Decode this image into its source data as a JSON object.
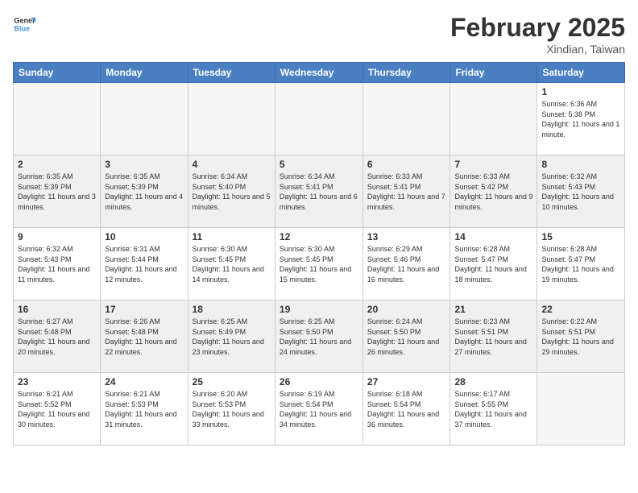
{
  "logo": {
    "line1": "General",
    "line2": "Blue"
  },
  "title": "February 2025",
  "location": "Xindian, Taiwan",
  "days_of_week": [
    "Sunday",
    "Monday",
    "Tuesday",
    "Wednesday",
    "Thursday",
    "Friday",
    "Saturday"
  ],
  "weeks": [
    {
      "shaded": false,
      "days": [
        {
          "num": "",
          "info": ""
        },
        {
          "num": "",
          "info": ""
        },
        {
          "num": "",
          "info": ""
        },
        {
          "num": "",
          "info": ""
        },
        {
          "num": "",
          "info": ""
        },
        {
          "num": "",
          "info": ""
        },
        {
          "num": "1",
          "info": "Sunrise: 6:36 AM\nSunset: 5:38 PM\nDaylight: 11 hours and 1 minute."
        }
      ]
    },
    {
      "shaded": true,
      "days": [
        {
          "num": "2",
          "info": "Sunrise: 6:35 AM\nSunset: 5:39 PM\nDaylight: 11 hours and 3 minutes."
        },
        {
          "num": "3",
          "info": "Sunrise: 6:35 AM\nSunset: 5:39 PM\nDaylight: 11 hours and 4 minutes."
        },
        {
          "num": "4",
          "info": "Sunrise: 6:34 AM\nSunset: 5:40 PM\nDaylight: 11 hours and 5 minutes."
        },
        {
          "num": "5",
          "info": "Sunrise: 6:34 AM\nSunset: 5:41 PM\nDaylight: 11 hours and 6 minutes."
        },
        {
          "num": "6",
          "info": "Sunrise: 6:33 AM\nSunset: 5:41 PM\nDaylight: 11 hours and 7 minutes."
        },
        {
          "num": "7",
          "info": "Sunrise: 6:33 AM\nSunset: 5:42 PM\nDaylight: 11 hours and 9 minutes."
        },
        {
          "num": "8",
          "info": "Sunrise: 6:32 AM\nSunset: 5:43 PM\nDaylight: 11 hours and 10 minutes."
        }
      ]
    },
    {
      "shaded": false,
      "days": [
        {
          "num": "9",
          "info": "Sunrise: 6:32 AM\nSunset: 5:43 PM\nDaylight: 11 hours and 11 minutes."
        },
        {
          "num": "10",
          "info": "Sunrise: 6:31 AM\nSunset: 5:44 PM\nDaylight: 11 hours and 12 minutes."
        },
        {
          "num": "11",
          "info": "Sunrise: 6:30 AM\nSunset: 5:45 PM\nDaylight: 11 hours and 14 minutes."
        },
        {
          "num": "12",
          "info": "Sunrise: 6:30 AM\nSunset: 5:45 PM\nDaylight: 11 hours and 15 minutes."
        },
        {
          "num": "13",
          "info": "Sunrise: 6:29 AM\nSunset: 5:46 PM\nDaylight: 11 hours and 16 minutes."
        },
        {
          "num": "14",
          "info": "Sunrise: 6:28 AM\nSunset: 5:47 PM\nDaylight: 11 hours and 18 minutes."
        },
        {
          "num": "15",
          "info": "Sunrise: 6:28 AM\nSunset: 5:47 PM\nDaylight: 11 hours and 19 minutes."
        }
      ]
    },
    {
      "shaded": true,
      "days": [
        {
          "num": "16",
          "info": "Sunrise: 6:27 AM\nSunset: 5:48 PM\nDaylight: 11 hours and 20 minutes."
        },
        {
          "num": "17",
          "info": "Sunrise: 6:26 AM\nSunset: 5:48 PM\nDaylight: 11 hours and 22 minutes."
        },
        {
          "num": "18",
          "info": "Sunrise: 6:25 AM\nSunset: 5:49 PM\nDaylight: 11 hours and 23 minutes."
        },
        {
          "num": "19",
          "info": "Sunrise: 6:25 AM\nSunset: 5:50 PM\nDaylight: 11 hours and 24 minutes."
        },
        {
          "num": "20",
          "info": "Sunrise: 6:24 AM\nSunset: 5:50 PM\nDaylight: 11 hours and 26 minutes."
        },
        {
          "num": "21",
          "info": "Sunrise: 6:23 AM\nSunset: 5:51 PM\nDaylight: 11 hours and 27 minutes."
        },
        {
          "num": "22",
          "info": "Sunrise: 6:22 AM\nSunset: 5:51 PM\nDaylight: 11 hours and 29 minutes."
        }
      ]
    },
    {
      "shaded": false,
      "days": [
        {
          "num": "23",
          "info": "Sunrise: 6:21 AM\nSunset: 5:52 PM\nDaylight: 11 hours and 30 minutes."
        },
        {
          "num": "24",
          "info": "Sunrise: 6:21 AM\nSunset: 5:53 PM\nDaylight: 11 hours and 31 minutes."
        },
        {
          "num": "25",
          "info": "Sunrise: 6:20 AM\nSunset: 5:53 PM\nDaylight: 11 hours and 33 minutes."
        },
        {
          "num": "26",
          "info": "Sunrise: 6:19 AM\nSunset: 5:54 PM\nDaylight: 11 hours and 34 minutes."
        },
        {
          "num": "27",
          "info": "Sunrise: 6:18 AM\nSunset: 5:54 PM\nDaylight: 11 hours and 36 minutes."
        },
        {
          "num": "28",
          "info": "Sunrise: 6:17 AM\nSunset: 5:55 PM\nDaylight: 11 hours and 37 minutes."
        },
        {
          "num": "",
          "info": ""
        }
      ]
    }
  ]
}
